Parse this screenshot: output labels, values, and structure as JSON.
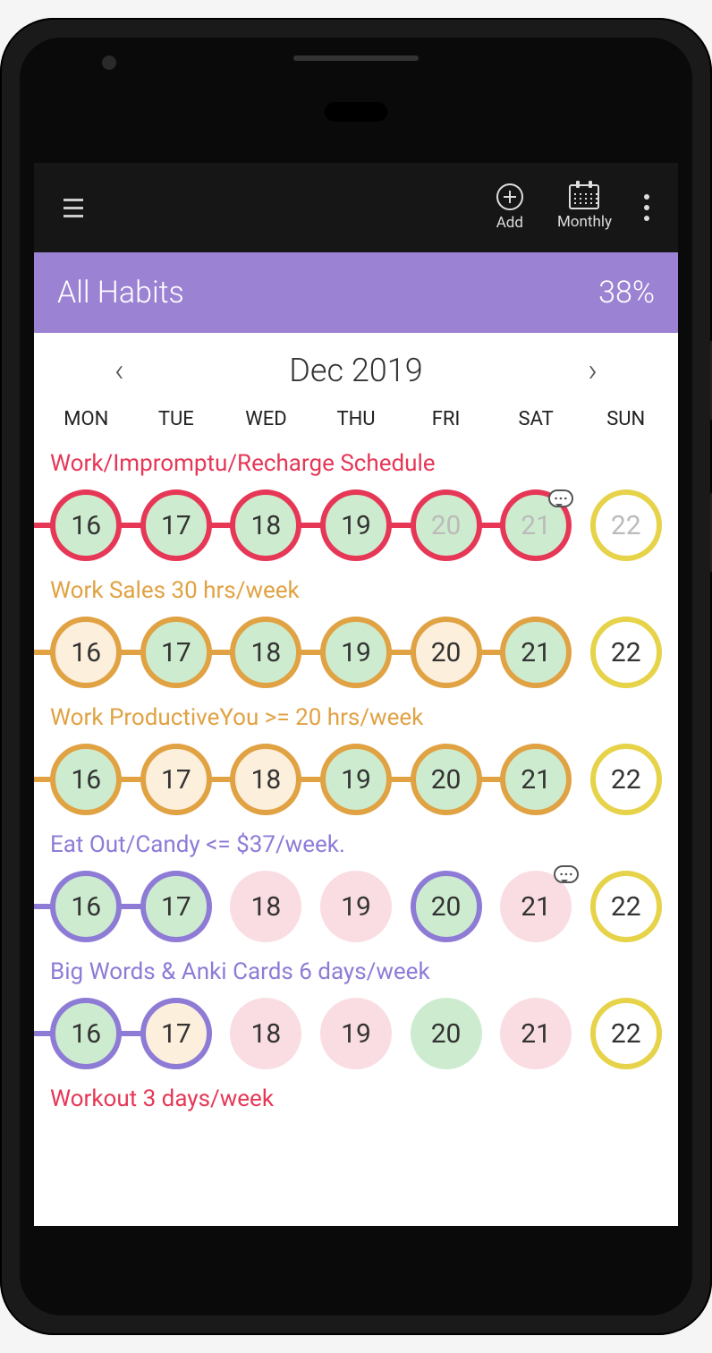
{
  "appbar": {
    "add_label": "Add",
    "monthly_label": "Monthly"
  },
  "summary": {
    "title": "All Habits",
    "percent": "38%"
  },
  "monthnav": {
    "title": "Dec 2019"
  },
  "weekdays": [
    "MON",
    "TUE",
    "WED",
    "THU",
    "FRI",
    "SAT",
    "SUN"
  ],
  "days": [
    "16",
    "17",
    "18",
    "19",
    "20",
    "21",
    "22"
  ],
  "habits": [
    {
      "title": "Work/Impromptu/Recharge Schedule",
      "color": "red",
      "connect_from": 0,
      "connect_to": 5,
      "cells": [
        {
          "ring": true,
          "fill": "green",
          "faded": false
        },
        {
          "ring": true,
          "fill": "green",
          "faded": false
        },
        {
          "ring": true,
          "fill": "green",
          "faded": false
        },
        {
          "ring": true,
          "fill": "green",
          "faded": false
        },
        {
          "ring": true,
          "fill": "green",
          "faded": true
        },
        {
          "ring": true,
          "fill": "green",
          "faded": true,
          "note": true
        },
        {
          "ring": true,
          "ring_yellow": true,
          "fill": "white",
          "faded": true
        }
      ]
    },
    {
      "title": "Work Sales 30 hrs/week",
      "color": "orange",
      "connect_from": 0,
      "connect_to": 5,
      "cells": [
        {
          "ring": true,
          "fill": "cream"
        },
        {
          "ring": true,
          "fill": "green"
        },
        {
          "ring": true,
          "fill": "green"
        },
        {
          "ring": true,
          "fill": "green"
        },
        {
          "ring": true,
          "fill": "cream"
        },
        {
          "ring": true,
          "fill": "green"
        },
        {
          "ring": true,
          "ring_yellow": true,
          "fill": "white"
        }
      ]
    },
    {
      "title": "Work ProductiveYou >= 20 hrs/week",
      "color": "orange",
      "connect_from": 0,
      "connect_to": 5,
      "cells": [
        {
          "ring": true,
          "fill": "green"
        },
        {
          "ring": true,
          "fill": "cream"
        },
        {
          "ring": true,
          "fill": "cream"
        },
        {
          "ring": true,
          "fill": "green"
        },
        {
          "ring": true,
          "fill": "green"
        },
        {
          "ring": true,
          "fill": "green"
        },
        {
          "ring": true,
          "ring_yellow": true,
          "fill": "white"
        }
      ]
    },
    {
      "title": "Eat Out/Candy <= $37/week.",
      "color": "purple",
      "connect_from": 0,
      "connect_to": 1,
      "cells": [
        {
          "ring": true,
          "fill": "green"
        },
        {
          "ring": true,
          "fill": "green"
        },
        {
          "ring": false,
          "fill": "pink"
        },
        {
          "ring": false,
          "fill": "pink"
        },
        {
          "ring": true,
          "fill": "green"
        },
        {
          "ring": false,
          "fill": "pink",
          "note": true
        },
        {
          "ring": true,
          "ring_yellow": true,
          "fill": "white"
        }
      ]
    },
    {
      "title": "Big Words & Anki Cards 6 days/week",
      "color": "purple",
      "connect_from": 0,
      "connect_to": 1,
      "cells": [
        {
          "ring": true,
          "fill": "green"
        },
        {
          "ring": true,
          "fill": "cream"
        },
        {
          "ring": false,
          "fill": "pink"
        },
        {
          "ring": false,
          "fill": "pink"
        },
        {
          "ring": false,
          "fill": "green"
        },
        {
          "ring": false,
          "fill": "pink"
        },
        {
          "ring": true,
          "ring_yellow": true,
          "fill": "white"
        }
      ]
    },
    {
      "title": "Workout 3 days/week",
      "color": "red",
      "connect_from": -1,
      "connect_to": -1,
      "cells": []
    }
  ]
}
